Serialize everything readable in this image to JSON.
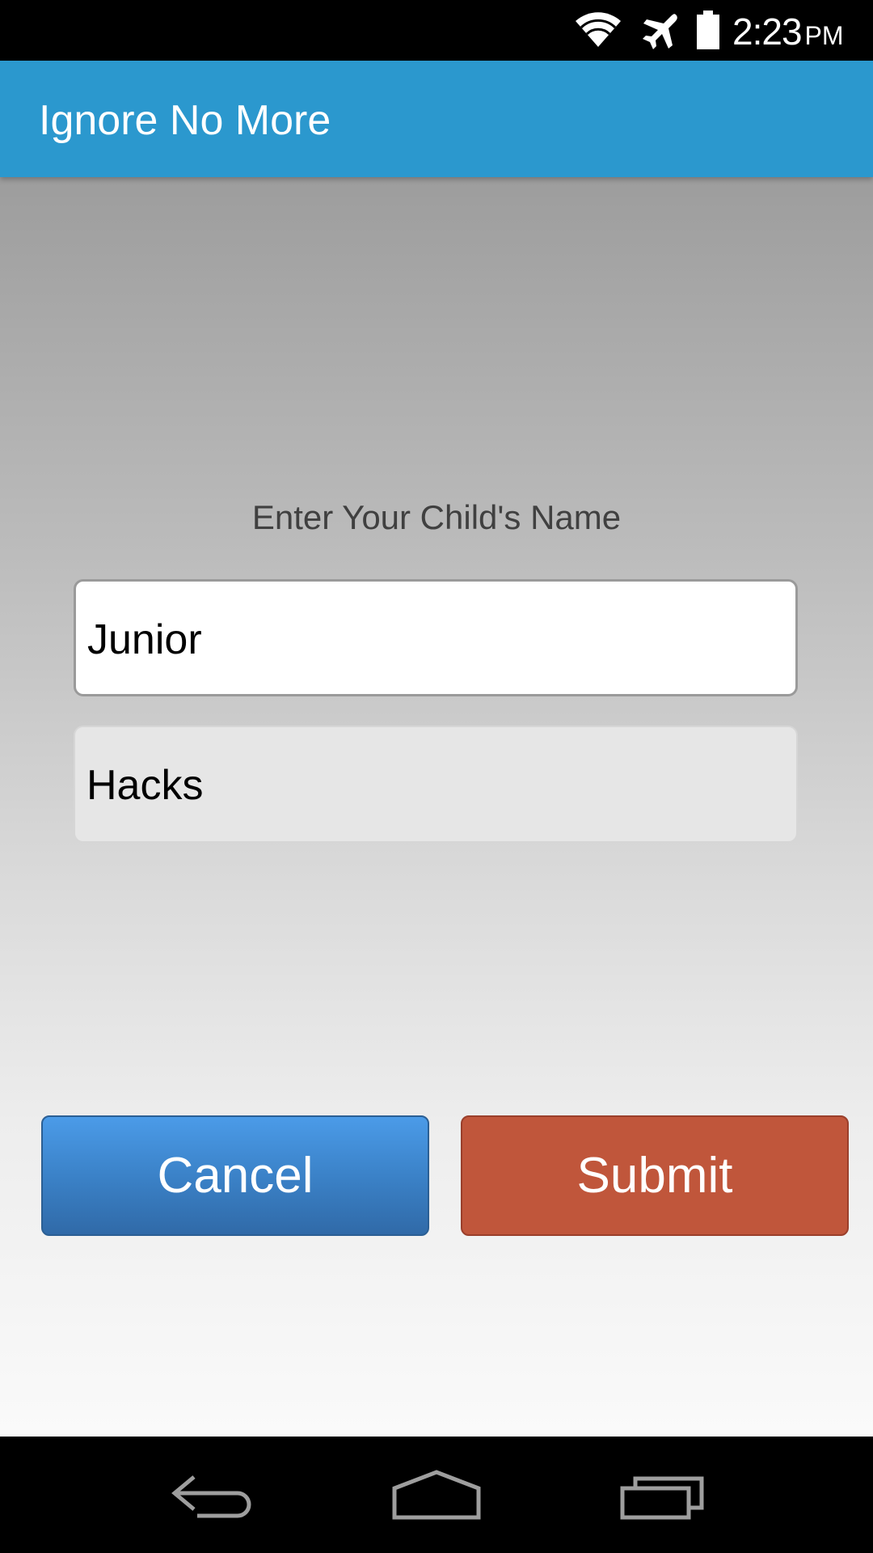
{
  "status_bar": {
    "time": "2:23",
    "ampm": "PM",
    "icons": [
      "wifi-icon",
      "airplane-mode-icon",
      "battery-icon"
    ]
  },
  "app_bar": {
    "title": "Ignore No More",
    "color": "#2b98ce"
  },
  "form": {
    "prompt": "Enter Your Child's Name",
    "first_name_value": "Junior",
    "last_name_value": "Hacks"
  },
  "buttons": {
    "cancel_label": "Cancel",
    "submit_label": "Submit",
    "cancel_color": "#3b82c8",
    "submit_color": "#c0563b"
  },
  "nav_bar": {
    "icons": [
      "back-icon",
      "home-icon",
      "recents-icon"
    ]
  }
}
